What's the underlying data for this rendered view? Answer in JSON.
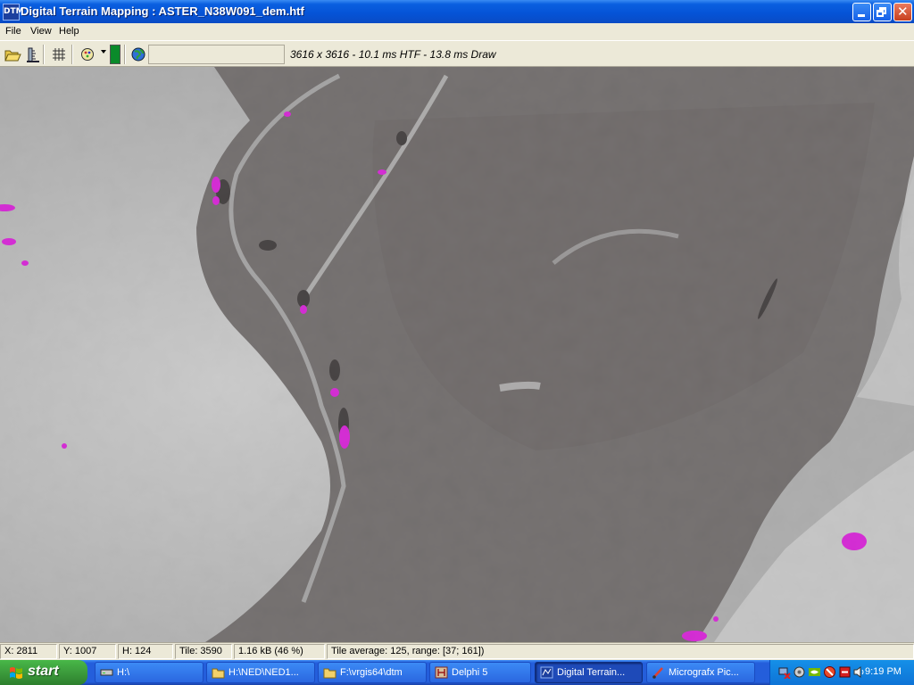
{
  "window": {
    "title": "Digital Terrain Mapping : ASTER_N38W091_dem.htf",
    "icon_label": "DTM",
    "icon": "app-icon"
  },
  "menu": [
    "File",
    "View",
    "Help"
  ],
  "toolbar": {
    "status": "3616 x 3616 - 10.1 ms HTF - 13.8 ms Draw",
    "icons": [
      "open-folder-icon",
      "ruler-icon",
      "grid-icon",
      "palette-icon",
      "globe-icon"
    ],
    "color_swatch": "#0A8A2A"
  },
  "statusbar": {
    "x": "X: 2811",
    "y": "Y: 1007",
    "h": "H: 124",
    "tile": "Tile: 3590",
    "size": "1.16 kB (46 %)",
    "tile_average": "Tile average: 125, range: [37; 161])"
  },
  "taskbar": {
    "start": "start",
    "tasks": [
      {
        "label": "H:\\",
        "icon": "drive-icon",
        "active": false
      },
      {
        "label": "H:\\NED\\NED1...",
        "icon": "folder-icon",
        "active": false
      },
      {
        "label": "F:\\vrgis64\\dtm",
        "icon": "folder-icon",
        "active": false
      },
      {
        "label": "Delphi 5",
        "icon": "delphi-icon",
        "active": false
      },
      {
        "label": "Digital Terrain...",
        "icon": "dtm-icon",
        "active": true
      },
      {
        "label": "Micrografx Pic...",
        "icon": "brush-icon",
        "active": false
      }
    ],
    "clock": "9:19 PM"
  },
  "colors": {
    "title_blue": "#0553D6",
    "terrain_low": "#6E6867",
    "terrain_high": "#E0E0E0",
    "highlight_magenta": "#FF00FF"
  }
}
